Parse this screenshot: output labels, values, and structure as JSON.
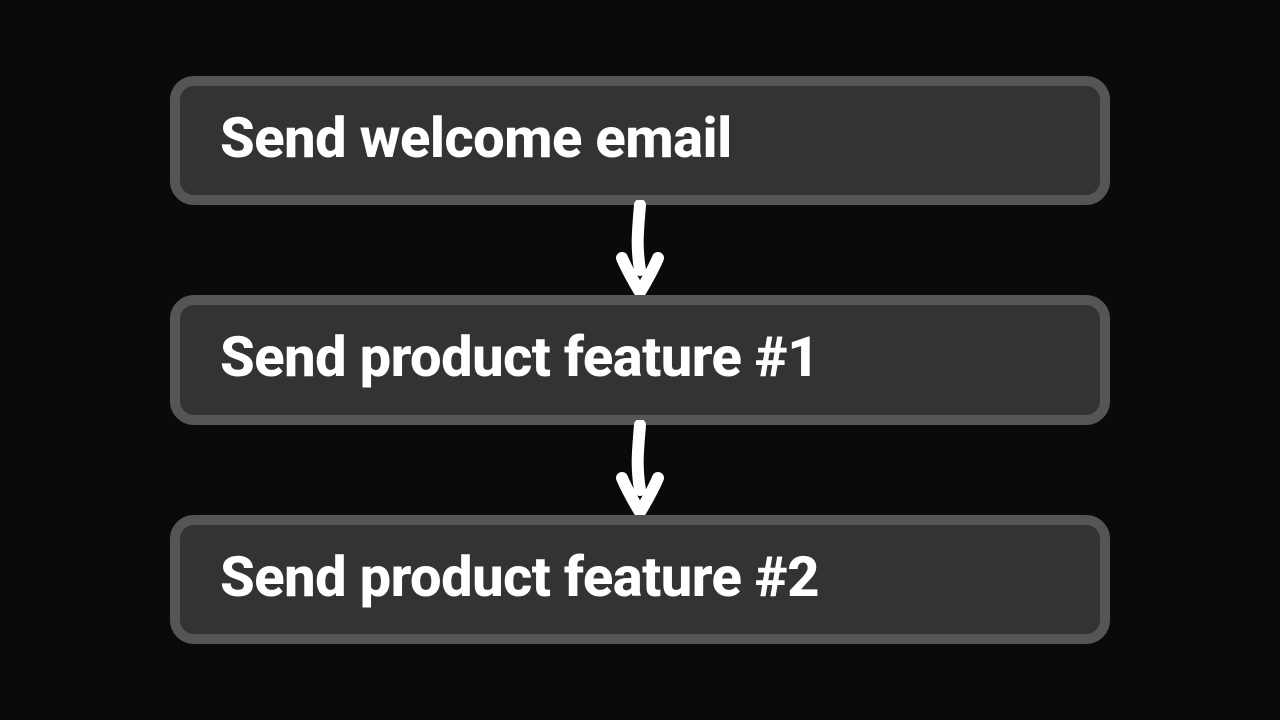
{
  "flow": {
    "steps": [
      {
        "label": "Send welcome email"
      },
      {
        "label": "Send product feature #1"
      },
      {
        "label": "Send product feature #2"
      }
    ]
  }
}
